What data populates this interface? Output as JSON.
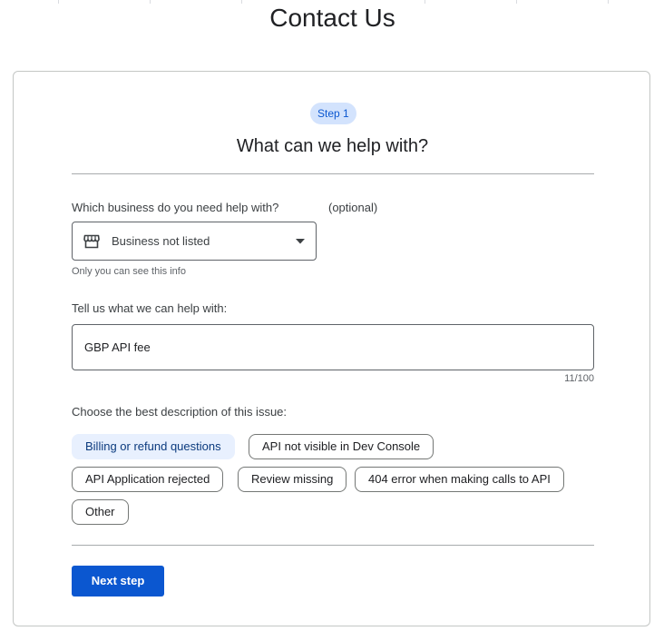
{
  "page": {
    "title": "Contact Us"
  },
  "step": {
    "badge": "Step 1",
    "title": "What can we help with?"
  },
  "business": {
    "label": "Which business do you need help with?",
    "optional": "(optional)",
    "selected": "Business not listed",
    "helper": "Only you can see this info",
    "icon": "store-icon"
  },
  "issue": {
    "label": "Tell us what we can help with:",
    "value": "GBP API fee",
    "counter": "11/100"
  },
  "description": {
    "label": "Choose the best description of this issue:",
    "options": [
      "Billing or refund questions",
      "API not visible in Dev Console",
      "API Application rejected",
      "Review missing",
      "404 error when making calls to API",
      "Other"
    ],
    "selected_index": 0
  },
  "actions": {
    "next_label": "Next step"
  },
  "colors": {
    "primary": "#0b57d0",
    "badge_bg": "#d3e3fd",
    "chip_selected_bg": "#e8f0fe"
  }
}
